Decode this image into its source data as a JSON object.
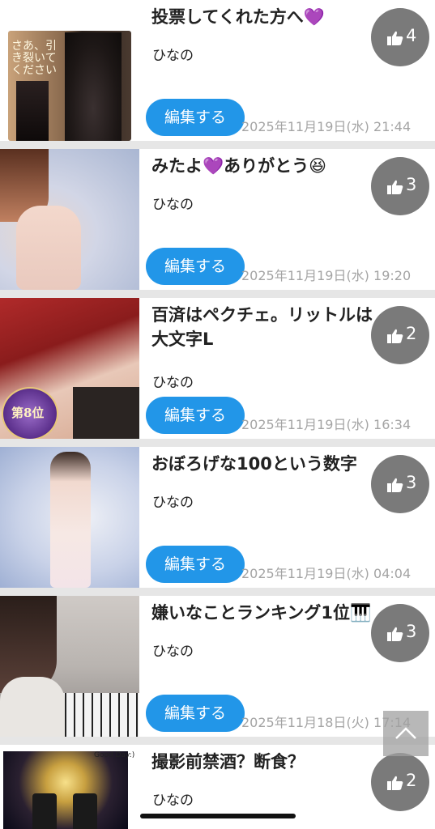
{
  "posts": [
    {
      "title": "投票してくれた方へ💜",
      "author": "ひなの",
      "edit_label": "編集する",
      "date": "2025年11月19日(水) 21:44",
      "likes": "4",
      "thumb_overlay": "さあ、引き裂いてください"
    },
    {
      "title": "みたよ💜ありがとう😆",
      "author": "ひなの",
      "edit_label": "編集する",
      "date": "2025年11月19日(水) 19:20",
      "likes": "3"
    },
    {
      "title": "百済はペクチェ。リットルは大文字L",
      "author": "ひなの",
      "edit_label": "編集する",
      "date": "2025年11月19日(水) 16:34",
      "likes": "2",
      "thumb_overlay": "第8位"
    },
    {
      "title": "おぼろげな100という数字",
      "author": "ひなの",
      "edit_label": "編集する",
      "date": "2025年11月19日(水) 04:04",
      "likes": "3"
    },
    {
      "title": "嫌いなことランキング1位🎹",
      "author": "ひなの",
      "edit_label": "編集する",
      "date": "2025年11月18日(火) 17:14",
      "likes": "3"
    },
    {
      "title": "撮影前禁酒？断食？",
      "author": "ひなの",
      "edit_label": "編集する",
      "date": "",
      "likes": "2",
      "thumb_overlay": "Good Day:)"
    }
  ],
  "colors": {
    "edit_button": "#2296e8",
    "like_badge": "#7a7a7a",
    "date_text": "#a4a4a4"
  },
  "icons": {
    "like": "thumbs-up-icon",
    "back_to_top": "chevron-up-icon"
  }
}
